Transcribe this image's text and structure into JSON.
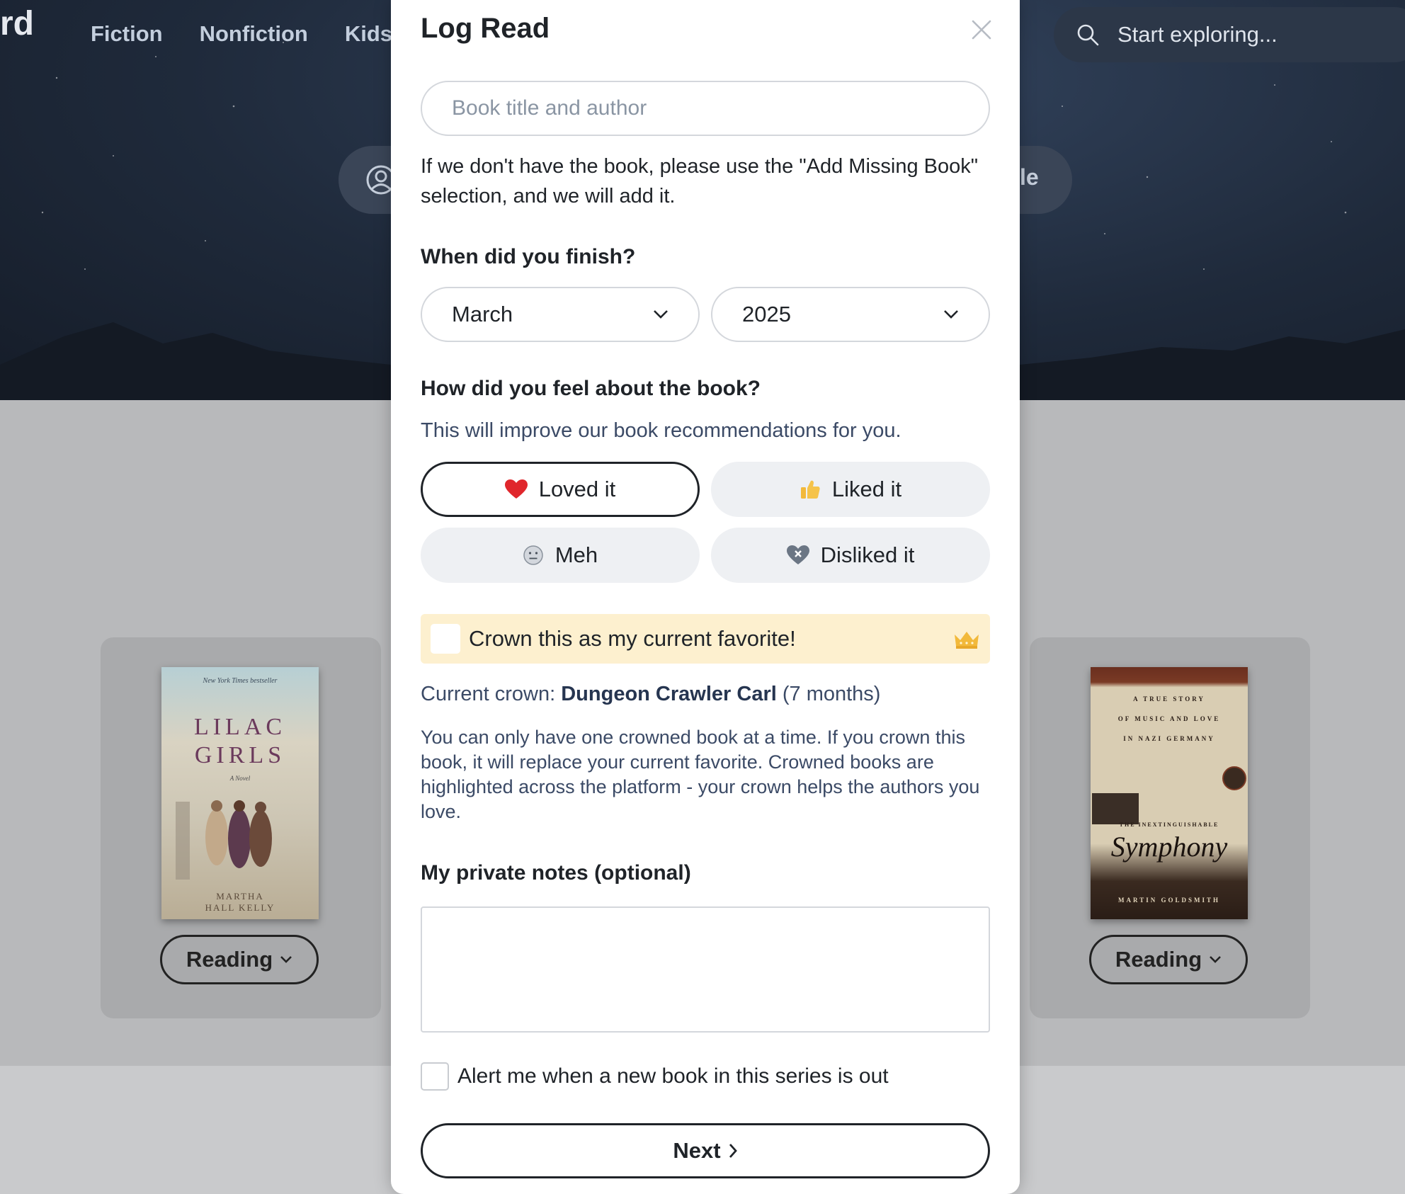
{
  "background": {
    "logo_fragment": "rd",
    "nav": [
      "Fiction",
      "Nonfiction",
      "Kids"
    ],
    "search": {
      "placeholder": "Start exploring..."
    },
    "hero_pill_right_text": "le",
    "books": [
      {
        "cover_lines": [
          "New York Times bestseller",
          "LILAC",
          "GIRLS",
          "A Novel",
          "MARTHA",
          "HALL KELLY"
        ],
        "status": "Reading"
      },
      {
        "cover_lines": [
          "A TRUE STORY",
          "OF MUSIC AND LOVE",
          "IN NAZI GERMANY",
          "THE INEXTINGUISHABLE",
          "Symphony",
          "MARTIN GOLDSMITH"
        ],
        "status": "Reading"
      }
    ]
  },
  "modal": {
    "title": "Log Read",
    "book_input": {
      "placeholder": "Book title and author",
      "value": ""
    },
    "helper_text": "If we don't have the book, please use the \"Add Missing Book\" selection, and we will add it.",
    "finish_label": "When did you finish?",
    "month": "March",
    "year": "2025",
    "feel_label": "How did you feel about the book?",
    "feel_subtext": "This will improve our book recommendations for you.",
    "feelings": {
      "loved": "Loved it",
      "liked": "Liked it",
      "meh": "Meh",
      "disliked": "Disliked it"
    },
    "selected_feeling": "loved",
    "crown": {
      "label": "Crown this as my current favorite!",
      "checked": false,
      "current_prefix": "Current crown: ",
      "current_title": "Dungeon Crawler Carl",
      "current_duration": " (7 months)",
      "info": "You can only have one crowned book at a time. If you crown this book, it will replace your current favorite. Crowned books are highlighted across the platform - your crown helps the authors you love."
    },
    "notes_label": "My private notes (optional)",
    "notes_value": "",
    "alert_label": "Alert me when a new book in this series is out",
    "next_label": "Next",
    "colors": {
      "heart": "#e0262c",
      "crown": "#f2b93b",
      "crown_bg": "#fdf0cf",
      "subtext": "#3b4a66"
    }
  }
}
